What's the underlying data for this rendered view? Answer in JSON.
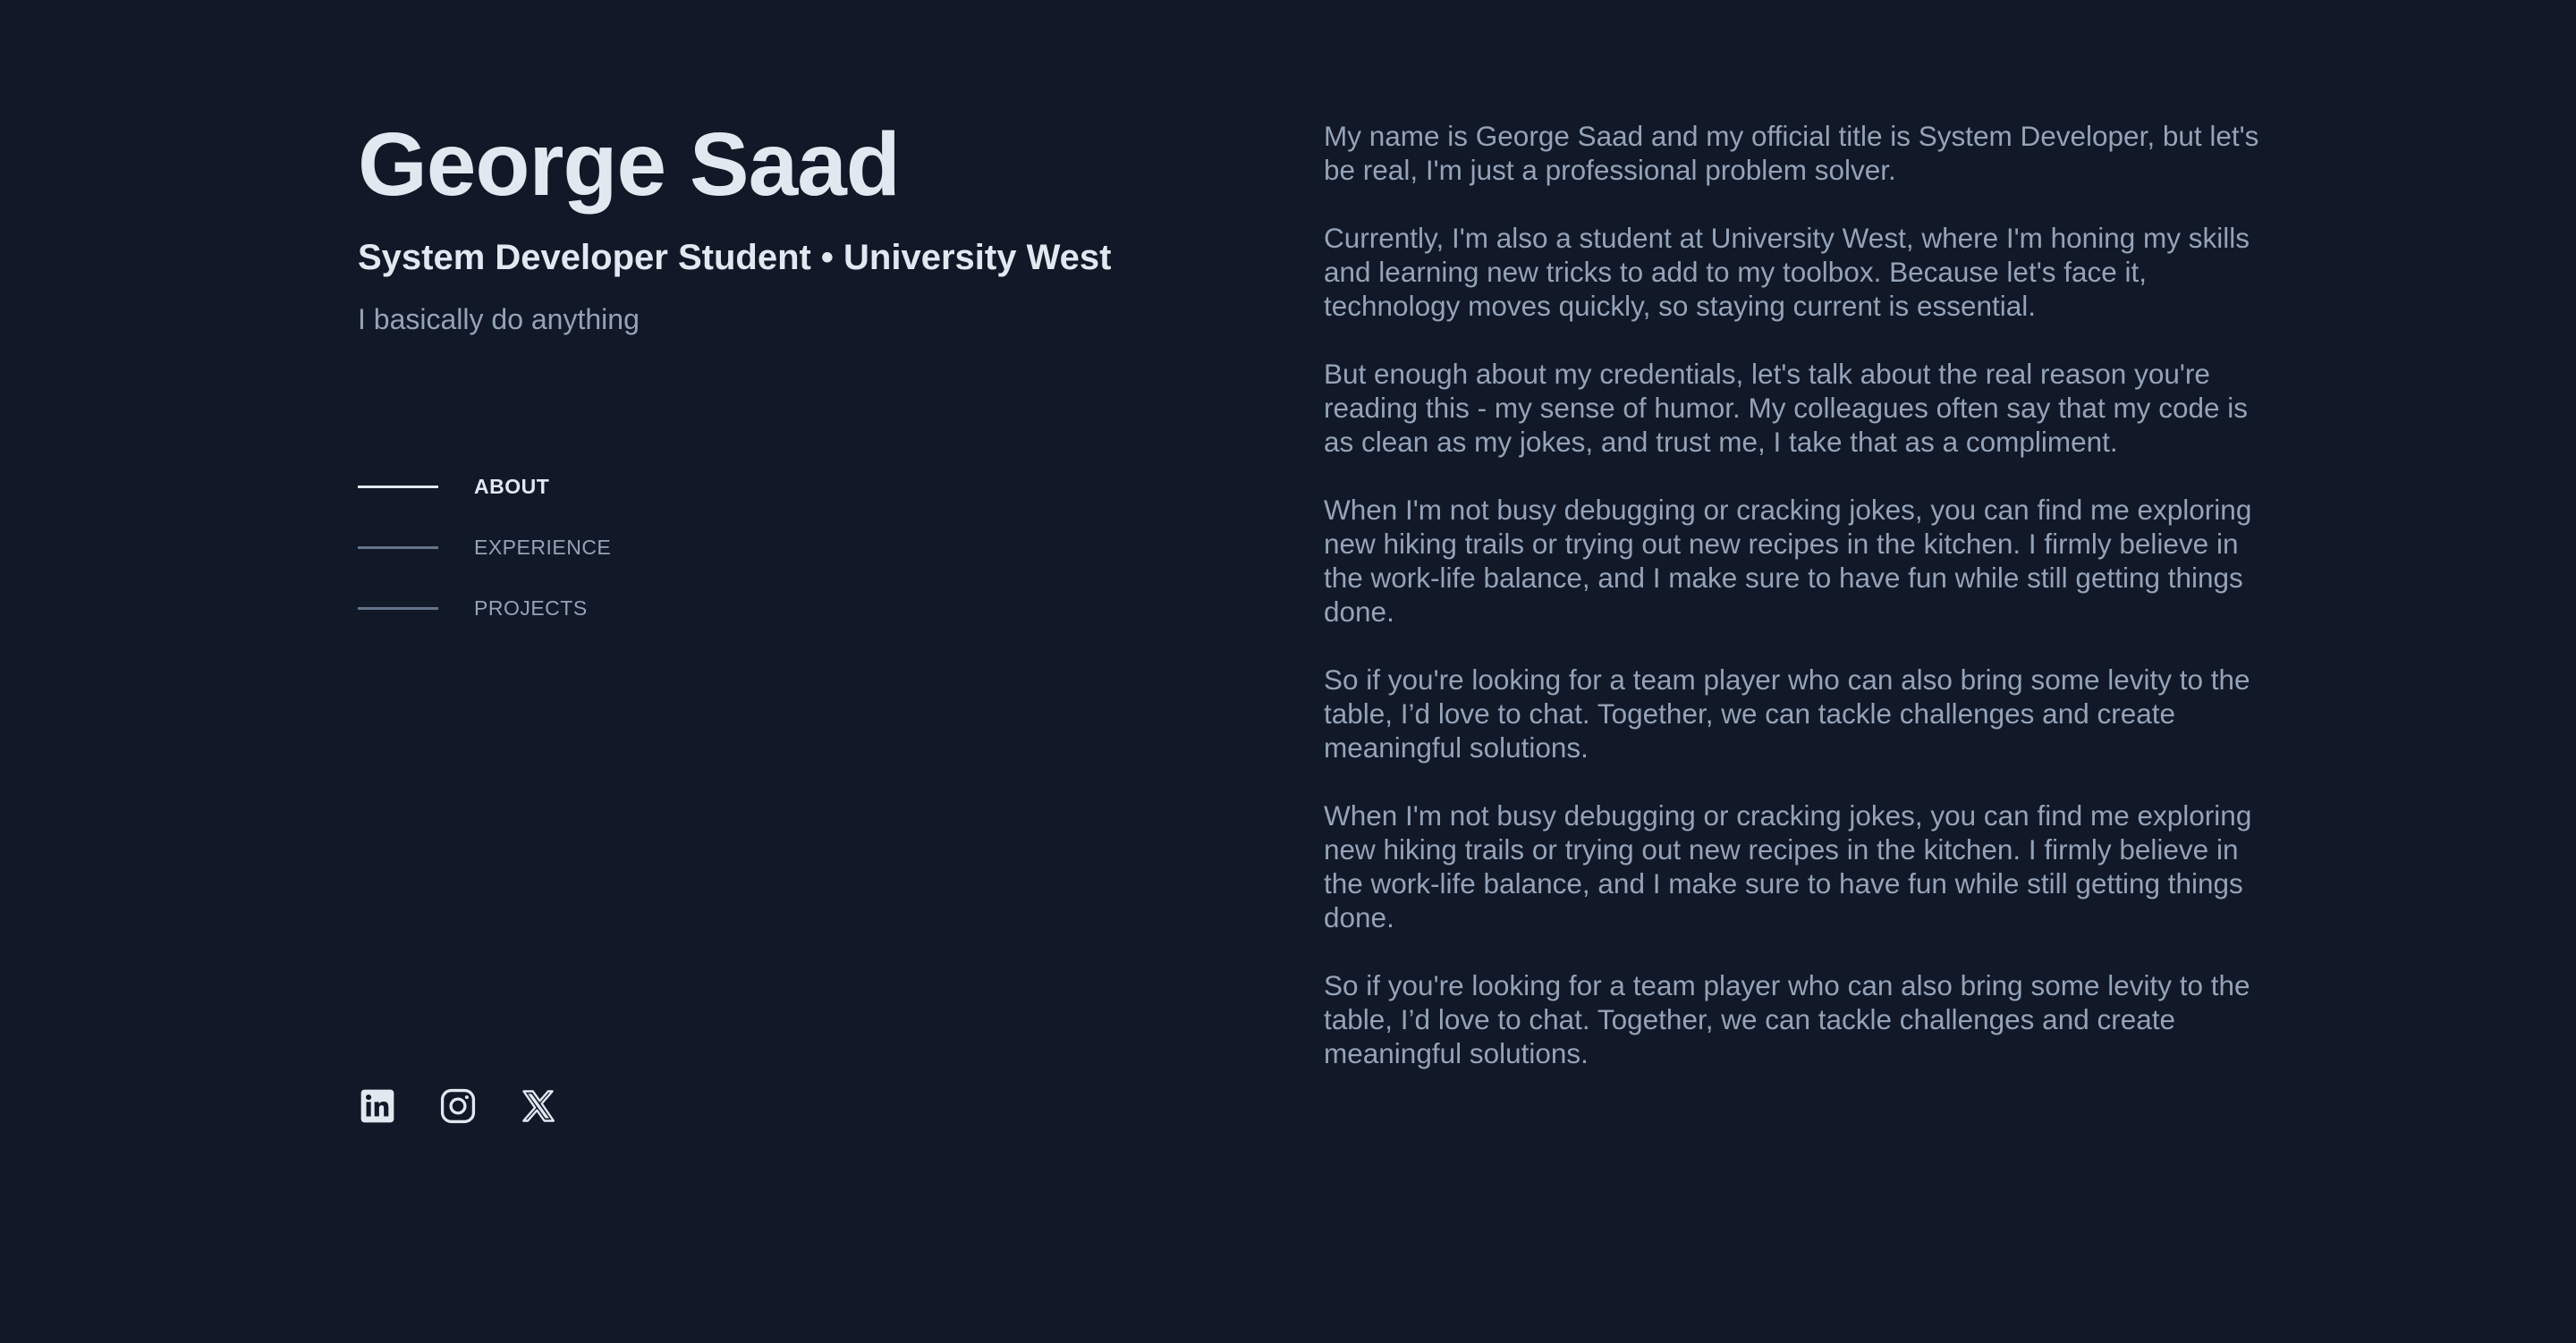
{
  "header": {
    "name": "George Saad",
    "subtitle": "System Developer Student • University West",
    "tagline": "I basically do anything"
  },
  "nav": {
    "items": [
      {
        "label": "ABOUT",
        "active": true
      },
      {
        "label": "EXPERIENCE",
        "active": false
      },
      {
        "label": "PROJECTS",
        "active": false
      }
    ]
  },
  "socials": {
    "items": [
      {
        "icon": "linkedin-icon"
      },
      {
        "icon": "instagram-icon"
      },
      {
        "icon": "x-icon"
      }
    ]
  },
  "about": {
    "paragraphs": [
      "My name is George Saad and my official title is System Developer, but let's be real, I'm just a professional problem solver.",
      "Currently, I'm also a student at University West, where I'm honing my skills and learning new tricks to add to my toolbox. Because let's face it, technology moves quickly, so staying current is essential.",
      "But enough about my credentials, let's talk about the real reason you're reading this - my sense of humor. My colleagues often say that my code is as clean as my jokes, and trust me, I take that as a compliment.",
      "When I'm not busy debugging or cracking jokes, you can find me exploring new hiking trails or trying out new recipes in the kitchen. I firmly believe in the work-life balance, and I make sure to have fun while still getting things done.",
      "So if you're looking for a team player who can also bring some levity to the table, I’d love to chat. Together, we can tackle challenges and create meaningful solutions.",
      "When I'm not busy debugging or cracking jokes, you can find me exploring new hiking trails or trying out new recipes in the kitchen. I firmly believe in the work-life balance, and I make sure to have fun while still getting things done.",
      "So if you're looking for a team player who can also bring some levity to the table, I’d love to chat. Together, we can tackle challenges and create meaningful solutions."
    ]
  },
  "colors": {
    "background": "#111827",
    "heading": "#e2e8f0",
    "muted": "#94a3b8",
    "line": "#64748b"
  }
}
